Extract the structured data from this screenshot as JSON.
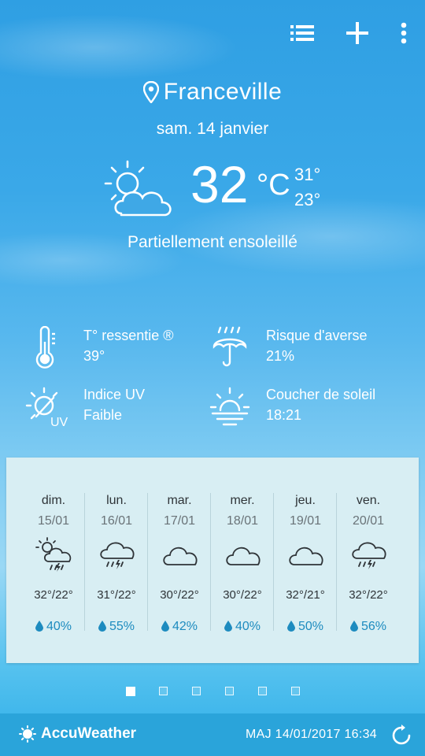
{
  "header": {
    "city": "Franceville",
    "date": "sam. 14 janvier",
    "icons": [
      "list-icon",
      "plus-icon",
      "more-vert-icon"
    ]
  },
  "current": {
    "temp": "32",
    "unit": "°C",
    "high": "31°",
    "low": "23°",
    "condition": "Partiellement ensoleillé",
    "icon": "partly-sunny-icon"
  },
  "details": [
    {
      "label": "T° ressentie ®",
      "value": "39°",
      "icon": "thermometer-icon"
    },
    {
      "label": "Risque d'averse",
      "value": "21%",
      "icon": "umbrella-rain-icon"
    },
    {
      "label": "Indice UV",
      "value": "Faible",
      "icon": "uv-index-icon"
    },
    {
      "label": "Coucher de soleil",
      "value": "18:21",
      "icon": "sunset-icon"
    }
  ],
  "forecast": [
    {
      "day": "dim.",
      "date": "15/01",
      "temps": "32°/22°",
      "rain": "40%",
      "icon": "sun-cloud-thunder-icon"
    },
    {
      "day": "lun.",
      "date": "16/01",
      "temps": "31°/22°",
      "rain": "55%",
      "icon": "cloud-thunder-icon"
    },
    {
      "day": "mar.",
      "date": "17/01",
      "temps": "30°/22°",
      "rain": "42%",
      "icon": "cloud-icon"
    },
    {
      "day": "mer.",
      "date": "18/01",
      "temps": "30°/22°",
      "rain": "40%",
      "icon": "cloud-icon"
    },
    {
      "day": "jeu.",
      "date": "19/01",
      "temps": "32°/21°",
      "rain": "50%",
      "icon": "cloud-icon"
    },
    {
      "day": "ven.",
      "date": "20/01",
      "temps": "32°/22°",
      "rain": "56%",
      "icon": "cloud-thunder-icon"
    }
  ],
  "pager": {
    "count": 6,
    "active_index": 0
  },
  "footer": {
    "brand": "AccuWeather",
    "updated": "MAJ 14/01/2017 16:34"
  },
  "colors": {
    "accent": "#2aa4da",
    "rain_text": "#1d8bbf",
    "panel": "#d8eef3"
  }
}
